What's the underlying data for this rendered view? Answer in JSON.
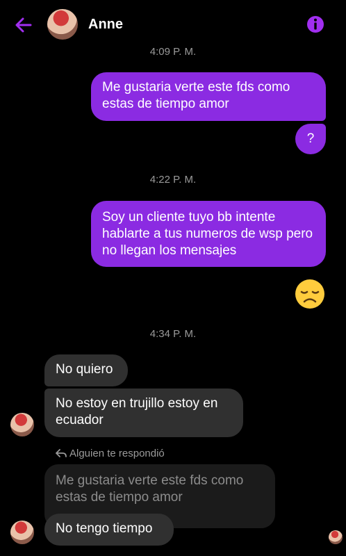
{
  "header": {
    "contact_name": "Anne",
    "back_icon": "arrow-left-icon",
    "info_icon": "info-icon",
    "accent": "#a12ef0"
  },
  "messages": {
    "ts1": "4:09 P. M.",
    "out1": "Me gustaria verte este fds como estas de tiempo amor",
    "out2": "?",
    "ts2": "4:22 P. M.",
    "out3": "Soy un cliente tuyo bb intente hablarte a tus numeros de wsp pero no llegan los mensajes",
    "emoji": "disappointed-face",
    "ts3": "4:34 P. M.",
    "in1": "No quiero",
    "in2": "No estoy en trujillo estoy en ecuador",
    "reply_label": "Alguien te respondió",
    "quoted": "Me gustaria verte este fds como estas de tiempo amor",
    "in3": "No tengo tiempo"
  },
  "colors": {
    "outgoing_bubble": "#8b2be2",
    "incoming_bubble": "#303030",
    "background": "#000000"
  }
}
